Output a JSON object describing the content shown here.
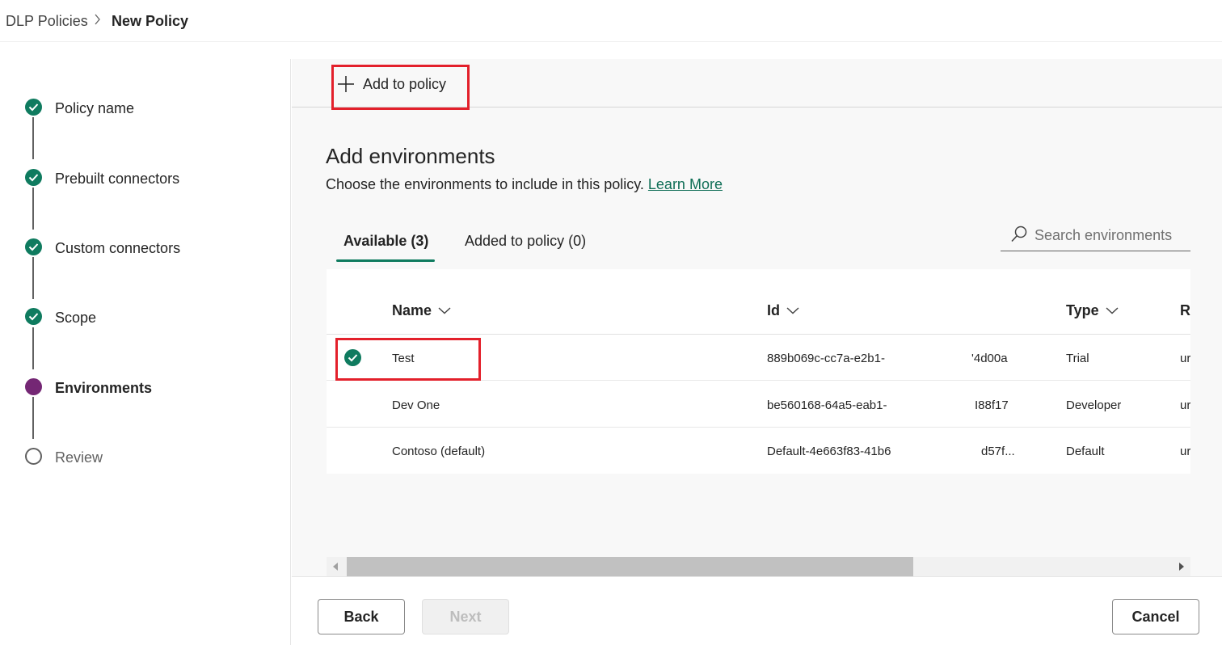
{
  "breadcrumb": {
    "parent": "DLP Policies",
    "current": "New Policy"
  },
  "stepper": {
    "steps": [
      {
        "label": "Policy name",
        "status": "done"
      },
      {
        "label": "Prebuilt connectors",
        "status": "done"
      },
      {
        "label": "Custom connectors",
        "status": "done"
      },
      {
        "label": "Scope",
        "status": "done"
      },
      {
        "label": "Environments",
        "status": "current"
      },
      {
        "label": "Review",
        "status": "todo"
      }
    ]
  },
  "command_bar": {
    "add_label": "Add to policy",
    "icon": "plus-icon"
  },
  "section": {
    "title": "Add environments",
    "description": "Choose the environments to include in this policy.",
    "learn_more": "Learn More"
  },
  "tabs": [
    {
      "label": "Available (3)",
      "selected": true
    },
    {
      "label": "Added to policy (0)",
      "selected": false
    }
  ],
  "search": {
    "placeholder": "Search environments",
    "icon": "search-icon"
  },
  "table": {
    "columns": [
      "Name",
      "Id",
      "Type",
      "Re"
    ],
    "rows": [
      {
        "selected": true,
        "name": "Test",
        "id_start": "889b069c-cc7a-e2b1-",
        "id_end": "'4d00a",
        "type": "Trial",
        "region": "ur"
      },
      {
        "selected": false,
        "name": "Dev One",
        "id_start": "be560168-64a5-eab1-",
        "id_end": "I88f17",
        "type": "Developer",
        "region": "ur"
      },
      {
        "selected": false,
        "name": "Contoso (default)",
        "id_start": "Default-4e663f83-41b6",
        "id_end": "d57f...",
        "type": "Default",
        "region": "ur"
      }
    ]
  },
  "footer": {
    "back": "Back",
    "next": "Next",
    "cancel": "Cancel"
  },
  "colors": {
    "accent_green": "#0f7b5f",
    "current_step": "#742774",
    "highlight_red": "#e3202b"
  }
}
